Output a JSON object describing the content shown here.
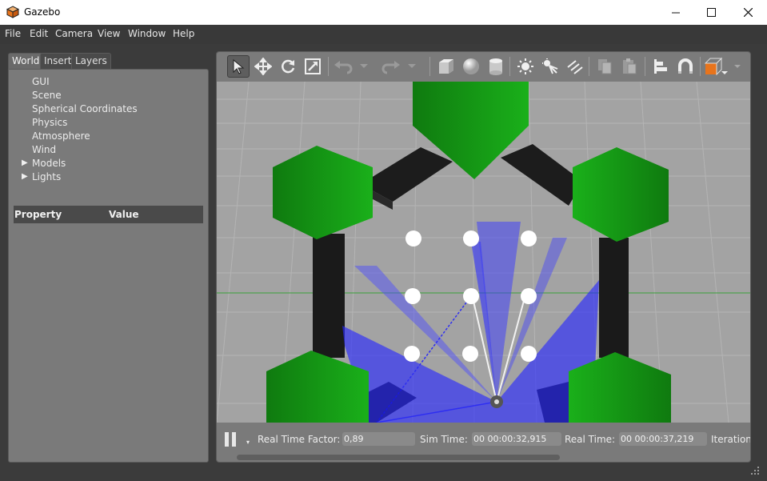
{
  "window": {
    "title": "Gazebo",
    "icon": "gazebo-box-icon",
    "controls": [
      "minimize-icon",
      "maximize-icon",
      "close-icon"
    ]
  },
  "menu": [
    "File",
    "Edit",
    "Camera",
    "View",
    "Window",
    "Help"
  ],
  "left_panel": {
    "tabs": [
      "World",
      "Insert",
      "Layers"
    ],
    "active_tab": "World",
    "tree": [
      "GUI",
      "Scene",
      "Spherical Coordinates",
      "Physics",
      "Atmosphere",
      "Wind",
      "Models",
      "Lights"
    ],
    "expandable": [
      "Models",
      "Lights"
    ],
    "property_header": {
      "property": "Property",
      "value": "Value"
    }
  },
  "toolbar": {
    "tools": [
      "select-arrow-icon",
      "translate-icon",
      "rotate-icon",
      "scale-icon",
      "undo-icon",
      "undo-history-icon",
      "redo-icon",
      "redo-history-icon",
      "box-shape-icon",
      "sphere-shape-icon",
      "cylinder-shape-icon",
      "point-light-icon",
      "spot-light-icon",
      "directional-light-icon",
      "copy-icon",
      "paste-icon",
      "align-icon",
      "snap-magnet-icon",
      "view-angle-icon"
    ],
    "active_tool": "select-arrow-icon",
    "accent": "#e8741c"
  },
  "status": {
    "real_time_factor_label": "Real Time Factor:",
    "real_time_factor": "0,89",
    "sim_time_label": "Sim Time:",
    "sim_time": "00 00:00:32,915",
    "real_time_label": "Real Time:",
    "real_time": "00 00:00:37,219",
    "iterations_label": "Iterations:"
  },
  "scene_colors": {
    "ground": "#a3a3a3",
    "pillar_green": "#1c9e1c",
    "wall_black": "#1a1a1a",
    "laser_blue": "#2a2aff"
  }
}
